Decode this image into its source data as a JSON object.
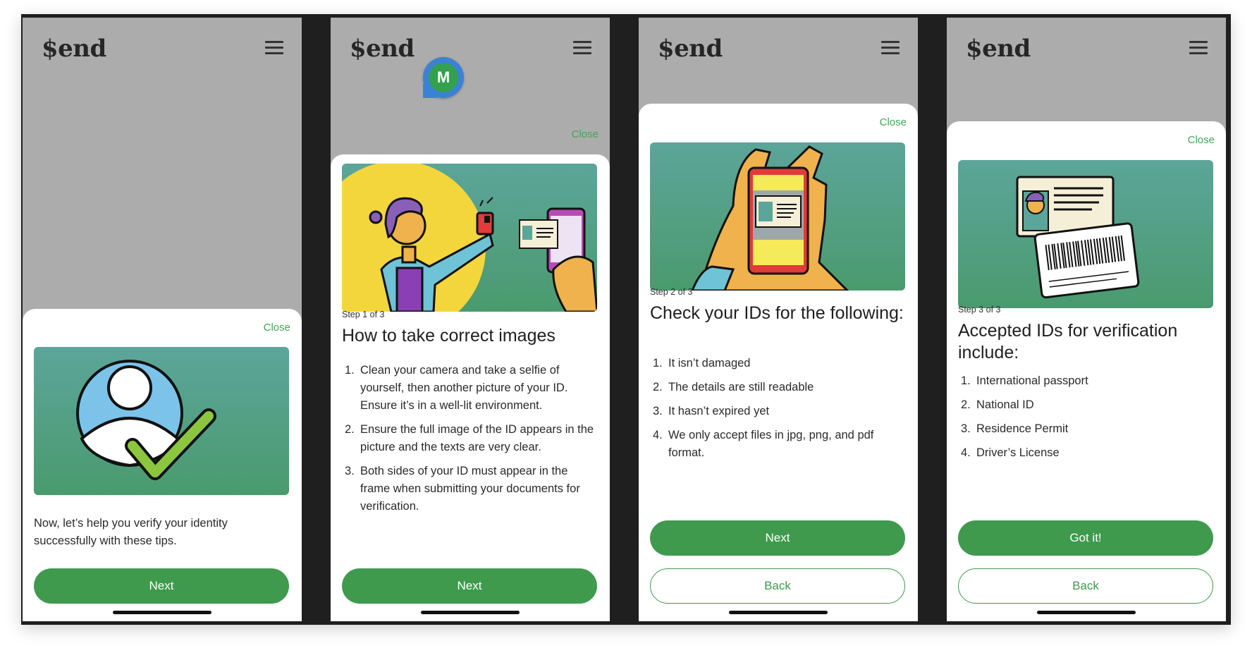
{
  "app": {
    "logo": "$end"
  },
  "avatar": {
    "initial": "M"
  },
  "screens": [
    {
      "close": "Close",
      "intro_text": "Now, let’s help you verify your identity successfully with these tips.",
      "next": "Next"
    },
    {
      "close": "Close",
      "step": "Step 1 of 3",
      "title": "How to take correct images",
      "items": [
        "Clean your camera and take a selfie of yourself, then another picture of your ID. Ensure it’s in a well-lit environment.",
        "Ensure the full image of the ID appears in the picture and the texts are very clear.",
        "Both sides of your ID must appear in the frame when submitting your documents for verification."
      ],
      "next": "Next"
    },
    {
      "close": "Close",
      "step": "Step 2 of 3",
      "title": "Check your IDs for the following:",
      "items": [
        "It isn’t damaged",
        "The details are still readable",
        "It hasn’t expired yet",
        "We only accept files in jpg, png, and pdf format."
      ],
      "next": "Next",
      "back": "Back"
    },
    {
      "close": "Close",
      "step": "Step 3 of 3",
      "title": "Accepted IDs for verification include:",
      "items": [
        "International passport",
        "National ID",
        "Residence Permit",
        "Driver’s License"
      ],
      "got_it": "Got it!",
      "back": "Back"
    }
  ],
  "numbers": [
    "1.",
    "2.",
    "3.",
    "4."
  ],
  "colors": {
    "brand_green": "#3f9a4e",
    "link_green": "#43a557",
    "illustration_teal": "#5ca59a",
    "backdrop_gray": "#acacac"
  }
}
